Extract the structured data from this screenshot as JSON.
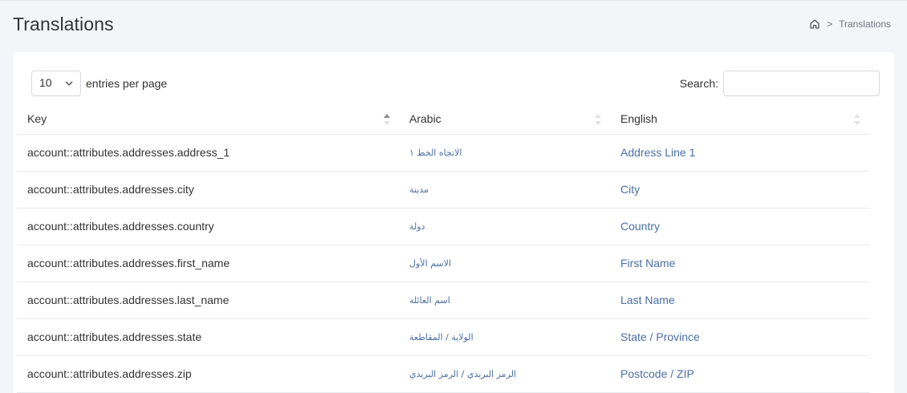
{
  "page": {
    "title": "Translations"
  },
  "breadcrumb": {
    "home_icon": "home-icon",
    "separator": ">",
    "current": "Translations"
  },
  "table_controls": {
    "length_value": "10",
    "length_label": "entries per page",
    "search_label": "Search:",
    "search_value": ""
  },
  "table": {
    "headers": [
      "Key",
      "Arabic",
      "English"
    ],
    "sort_state": [
      "ascending",
      "none",
      "none"
    ],
    "rows": [
      {
        "key": "account::attributes.addresses.address_1",
        "arabic": "الاتجاه الخط ١",
        "english": "Address Line 1"
      },
      {
        "key": "account::attributes.addresses.city",
        "arabic": "مدينة",
        "english": "City"
      },
      {
        "key": "account::attributes.addresses.country",
        "arabic": "دولة",
        "english": "Country"
      },
      {
        "key": "account::attributes.addresses.first_name",
        "arabic": "الاسم الأول",
        "english": "First Name"
      },
      {
        "key": "account::attributes.addresses.last_name",
        "arabic": "اسم العائلة",
        "english": "Last Name"
      },
      {
        "key": "account::attributes.addresses.state",
        "arabic": "الولاية / المقاطعة",
        "english": "State / Province"
      },
      {
        "key": "account::attributes.addresses.zip",
        "arabic": "الرمز البريدي / الرمز البريدي",
        "english": "Postcode / ZIP"
      }
    ]
  },
  "colors": {
    "link": "#4a6fa5",
    "background": "#f3f6f9",
    "card": "#ffffff"
  }
}
